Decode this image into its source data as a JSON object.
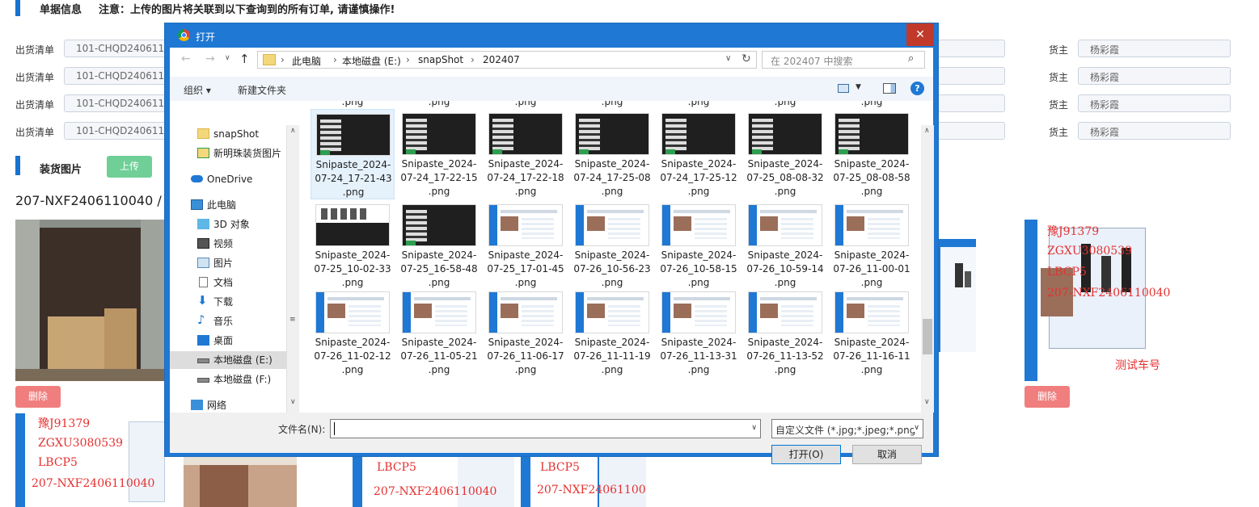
{
  "page": {
    "section_info_title": "单据信息",
    "notice": "注意：上传的图片将关联到以下查询到的所有订单, 请谨慎操作!",
    "rows": [
      {
        "label": "出货清单",
        "value": "101-CHQD2406110",
        "owner_label": "货主",
        "owner_value": "杨彩霞"
      },
      {
        "label": "出货清单",
        "value": "101-CHQD2406110",
        "owner_label": "货主",
        "owner_value": "杨彩霞"
      },
      {
        "label": "出货清单",
        "value": "101-CHQD2406110",
        "owner_label": "货主",
        "owner_value": "杨彩霞"
      },
      {
        "label": "出货清单",
        "value": "101-CHQD2406110",
        "owner_label": "货主",
        "owner_value": "杨彩霞"
      }
    ],
    "section_photo_title": "装货图片",
    "upload_label": "上传",
    "order_no": "207-NXF2406110040 / L",
    "delete_label": "删除",
    "overlay_texts": [
      "豫J91379",
      "ZGXU3080539",
      "LBCP5",
      "207-NXF2406110040",
      "测试车号"
    ]
  },
  "dialog": {
    "title": "打开",
    "close": "✕",
    "breadcrumb": [
      "此电脑",
      "本地磁盘 (E:)",
      "snapShot",
      "202407"
    ],
    "search_placeholder": "在 202407 中搜索",
    "organize_label": "组织 ▾",
    "new_folder_label": "新建文件夹",
    "nav_items": [
      {
        "label": "snapShot",
        "icon": "folder-icon"
      },
      {
        "label": "新明珠装货图片",
        "icon": "folder-sync-icon"
      },
      {
        "label": "OneDrive",
        "icon": "cloud-icon"
      },
      {
        "label": "此电脑",
        "icon": "computer-icon"
      },
      {
        "label": "3D 对象",
        "icon": "cube-icon"
      },
      {
        "label": "视频",
        "icon": "video-icon"
      },
      {
        "label": "图片",
        "icon": "picture-icon"
      },
      {
        "label": "文档",
        "icon": "document-icon"
      },
      {
        "label": "下载",
        "icon": "download-icon"
      },
      {
        "label": "音乐",
        "icon": "music-icon"
      },
      {
        "label": "桌面",
        "icon": "desktop-icon"
      },
      {
        "label": "本地磁盘 (E:)",
        "icon": "drive-icon"
      },
      {
        "label": "本地磁盘 (F:)",
        "icon": "drive-icon"
      },
      {
        "label": "网络",
        "icon": "network-icon"
      }
    ],
    "partial_row": [
      ".png",
      ".png",
      ".png",
      ".png",
      ".png",
      ".png",
      ".png"
    ],
    "files": [
      [
        "Snipaste_2024-",
        "07-24_17-21-43",
        ".png"
      ],
      [
        "Snipaste_2024-",
        "07-24_17-22-15",
        ".png"
      ],
      [
        "Snipaste_2024-",
        "07-24_17-22-18",
        ".png"
      ],
      [
        "Snipaste_2024-",
        "07-24_17-25-08",
        ".png"
      ],
      [
        "Snipaste_2024-",
        "07-24_17-25-12",
        ".png"
      ],
      [
        "Snipaste_2024-",
        "07-25_08-08-32",
        ".png"
      ],
      [
        "Snipaste_2024-",
        "07-25_08-08-58",
        ".png"
      ],
      [
        "Snipaste_2024-",
        "07-25_10-02-33",
        ".png"
      ],
      [
        "Snipaste_2024-",
        "07-25_16-58-48",
        ".png"
      ],
      [
        "Snipaste_2024-",
        "07-25_17-01-45",
        ".png"
      ],
      [
        "Snipaste_2024-",
        "07-26_10-56-23",
        ".png"
      ],
      [
        "Snipaste_2024-",
        "07-26_10-58-15",
        ".png"
      ],
      [
        "Snipaste_2024-",
        "07-26_10-59-14",
        ".png"
      ],
      [
        "Snipaste_2024-",
        "07-26_11-00-01",
        ".png"
      ],
      [
        "Snipaste_2024-",
        "07-26_11-02-12",
        ".png"
      ],
      [
        "Snipaste_2024-",
        "07-26_11-05-21",
        ".png"
      ],
      [
        "Snipaste_2024-",
        "07-26_11-06-17",
        ".png"
      ],
      [
        "Snipaste_2024-",
        "07-26_11-11-19",
        ".png"
      ],
      [
        "Snipaste_2024-",
        "07-26_11-13-31",
        ".png"
      ],
      [
        "Snipaste_2024-",
        "07-26_11-13-52",
        ".png"
      ],
      [
        "Snipaste_2024-",
        "07-26_11-16-11",
        ".png"
      ]
    ],
    "filename_label": "文件名(N):",
    "filename_value": "",
    "filetype_value": "自定义文件 (*.jpg;*.jpeg;*.png",
    "open_label": "打开(O)",
    "cancel_label": "取消"
  },
  "colors": {
    "accent": "#1e78d4",
    "close": "#c0392b",
    "upload": "#6fcf97",
    "delete": "#f07e7e",
    "overlay_red": "#e63030"
  }
}
